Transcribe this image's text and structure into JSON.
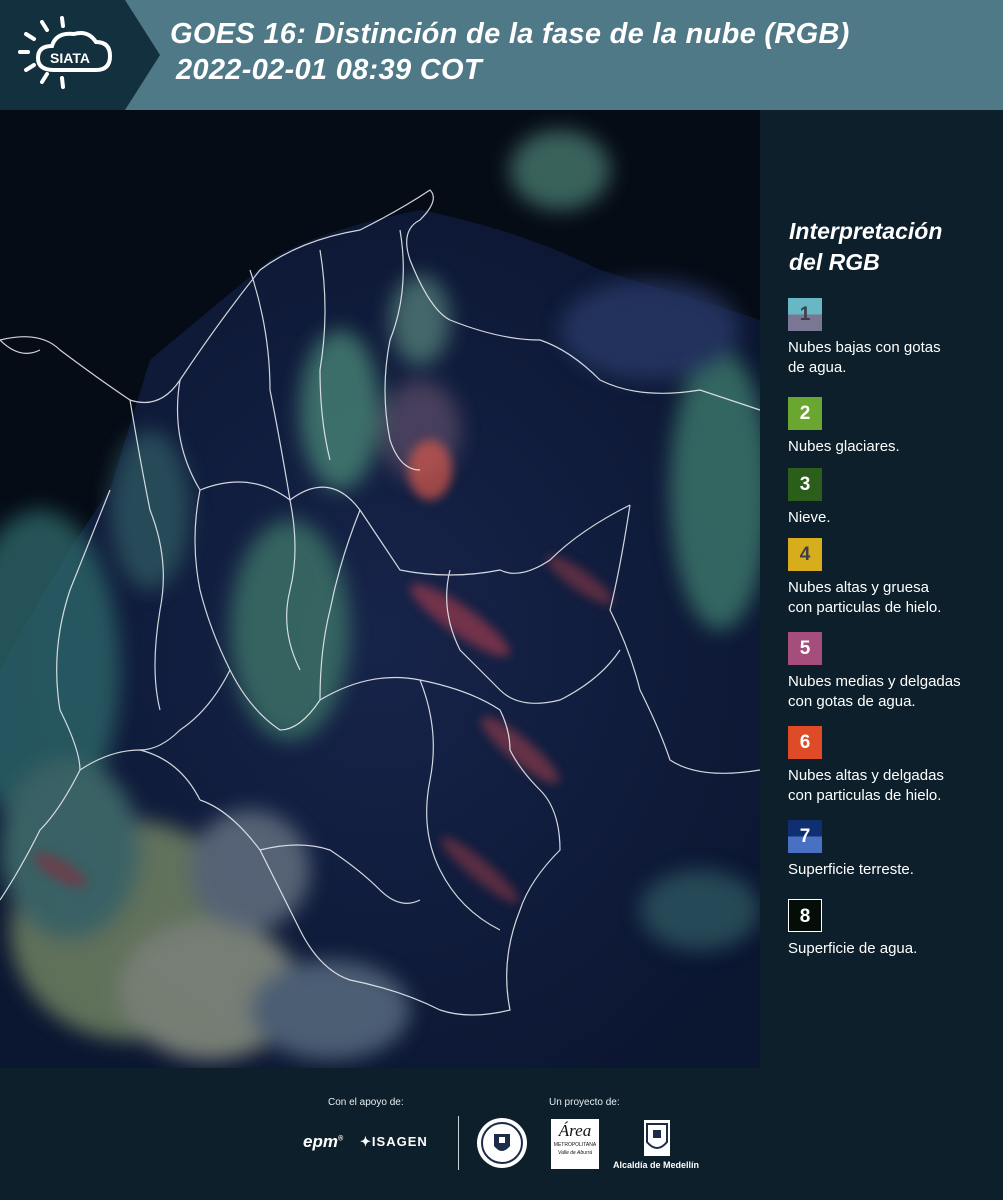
{
  "header": {
    "logo_text": "SIATA",
    "title_line1": "GOES 16: Distinción de la fase de la nube (RGB)",
    "title_line2": "2022-02-01 08:39 COT"
  },
  "legend": {
    "title_line1": "Interpretación",
    "title_line2": "del RGB",
    "items": [
      {
        "num": "1",
        "desc_line1": "Nubes bajas con gotas",
        "desc_line2": "de agua.",
        "color_top": "#67b7c5",
        "color_bottom": "#7a7794"
      },
      {
        "num": "2",
        "desc_line1": "Nubes glaciares.",
        "desc_line2": "",
        "color": "#6aa730"
      },
      {
        "num": "3",
        "desc_line1": "Nieve.",
        "desc_line2": "",
        "color": "#2c5e1b"
      },
      {
        "num": "4",
        "desc_line1": "Nubes altas y gruesa",
        "desc_line2": "con particulas de hielo.",
        "color": "#d7ad1c"
      },
      {
        "num": "5",
        "desc_line1": "Nubes medias y delgadas",
        "desc_line2": "con gotas de agua.",
        "color": "#a64e7b"
      },
      {
        "num": "6",
        "desc_line1": "Nubes altas y delgadas",
        "desc_line2": "con particulas de hielo.",
        "color": "#de4b26"
      },
      {
        "num": "7",
        "desc_line1": "Superficie terreste.",
        "desc_line2": "",
        "color_top": "#0f2f70",
        "color_bottom": "#4a70c2"
      },
      {
        "num": "8",
        "desc_line1": "Superficie de agua.",
        "desc_line2": "",
        "color": "#040d08"
      }
    ]
  },
  "footer": {
    "support_label": "Con el apoyo de:",
    "project_label": "Un proyecto de:",
    "sponsor1": "epm",
    "sponsor2": "ISAGEN",
    "area_name": "Área",
    "area_sub1": "METROPOLITANA",
    "area_sub2": "Valle de Aburrá",
    "alcaldia": "Alcaldía de Medellín"
  }
}
